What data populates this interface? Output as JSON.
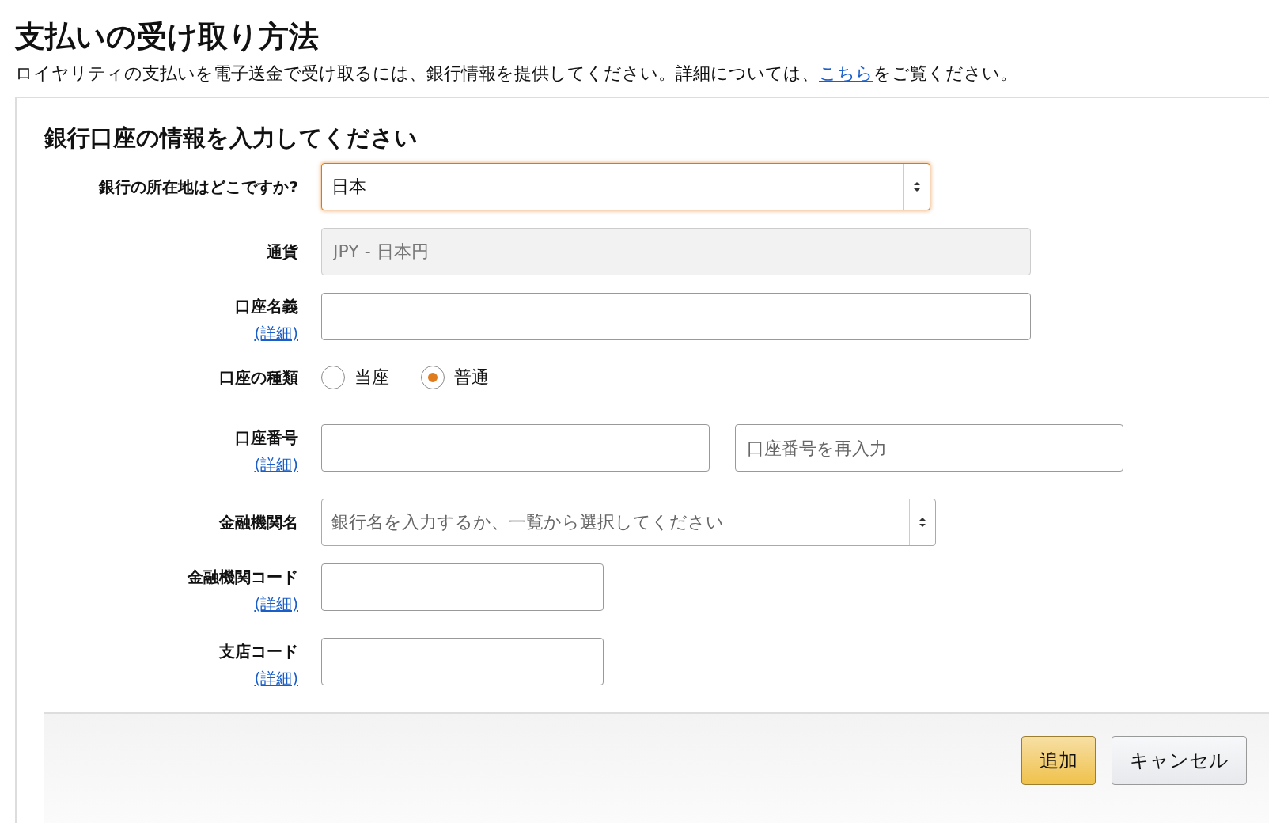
{
  "title": "支払いの受け取り方法",
  "description": {
    "before": "ロイヤリティの支払いを電子送金で受け取るには、銀行情報を提供してください。詳細については、",
    "link": "こちら",
    "after": "をご覧ください。"
  },
  "form": {
    "heading": "銀行口座の情報を入力してください",
    "rows": [
      {
        "kind": "select",
        "label": "銀行の所在地はどこですか?",
        "value": "日本",
        "focused": true
      },
      {
        "kind": "text",
        "label": "通貨",
        "value": "JPY - 日本円",
        "disabled": true
      },
      {
        "kind": "text",
        "label": "口座名義",
        "detail": "(詳細)",
        "disabled": false
      },
      {
        "kind": "radio",
        "label": "口座の種類",
        "options": [
          {
            "label": "当座",
            "selected": false
          },
          {
            "label": "普通",
            "selected": true
          }
        ]
      },
      {
        "kind": "double",
        "label": "口座番号",
        "detail": "(詳細)",
        "second_placeholder": "口座番号を再入力"
      },
      {
        "kind": "select",
        "label": "金融機関名",
        "placeholder": "銀行名を入力するか、一覧から選択してください",
        "focused": false
      },
      {
        "kind": "short_text",
        "label": "金融機関コード",
        "detail": "(詳細)"
      },
      {
        "kind": "short_text",
        "label": "支店コード",
        "detail": "(詳細)"
      }
    ]
  },
  "buttons": [
    {
      "label": "追加",
      "kind": "primary"
    },
    {
      "label": "キャンセル",
      "kind": "secondary"
    }
  ]
}
